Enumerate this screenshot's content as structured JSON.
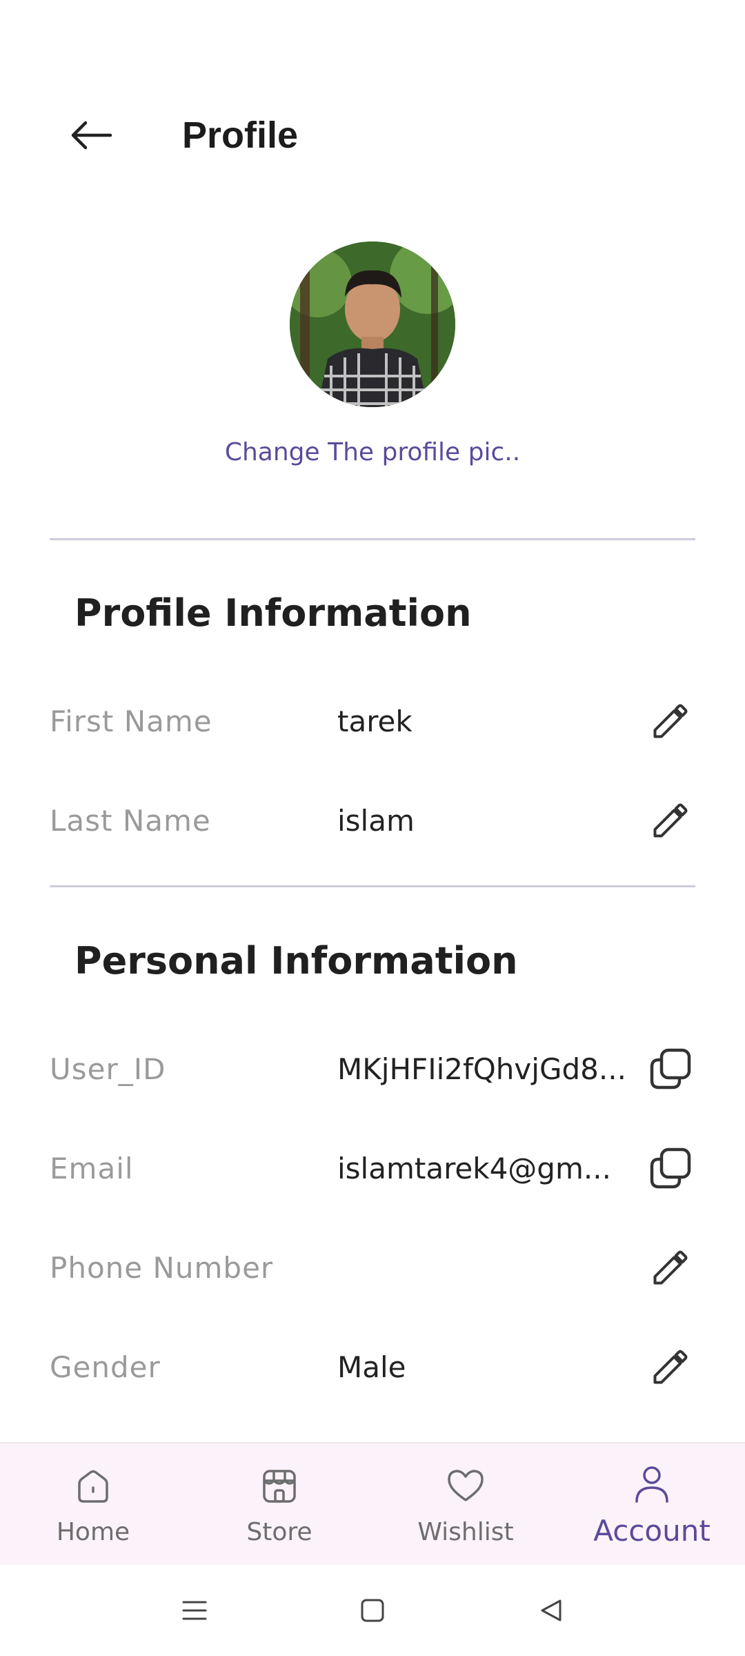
{
  "header": {
    "title": "Profile"
  },
  "profile": {
    "change_pic_label": "Change The profile pic.."
  },
  "profile_info": {
    "title": "Profile Information",
    "rows": [
      {
        "label": "First Name",
        "value": "tarek",
        "action_icon": "pencil-icon"
      },
      {
        "label": "Last Name",
        "value": "islam",
        "action_icon": "pencil-icon"
      }
    ]
  },
  "personal_info": {
    "title": "Personal Information",
    "rows": [
      {
        "label": "User_ID",
        "value": "MKjHFIi2fQhvjGd8...",
        "action_icon": "copy-icon"
      },
      {
        "label": "Email",
        "value": "islamtarek4@gm...",
        "action_icon": "copy-icon"
      },
      {
        "label": "Phone Number",
        "value": "",
        "action_icon": "pencil-icon"
      },
      {
        "label": "Gender",
        "value": "Male",
        "action_icon": "pencil-icon"
      }
    ]
  },
  "bottom_nav": {
    "items": [
      {
        "label": "Home",
        "icon": "home-icon",
        "active": false
      },
      {
        "label": "Store",
        "icon": "store-icon",
        "active": false
      },
      {
        "label": "Wishlist",
        "icon": "heart-icon",
        "active": false
      },
      {
        "label": "Account",
        "icon": "user-icon",
        "active": true
      }
    ]
  },
  "colors": {
    "accent": "#5b4a9a",
    "label_gray": "#9a9a9a",
    "nav_background": "#fbf3f9",
    "divider": "#cfcbdc"
  }
}
